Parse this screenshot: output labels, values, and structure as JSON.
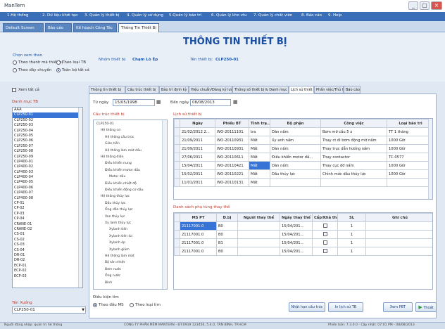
{
  "window": {
    "app_name": "ManTern",
    "buttons": [
      "_",
      "▢",
      "×"
    ]
  },
  "menu": [
    "1.Hệ thống",
    "2. Dữ liệu khởi tạo",
    "3. Quản lý thiết bị",
    "4. Quản lý sử dụng",
    "5.Quản lý bảo trì",
    "6. Quản lý kho vtu",
    "7. Quản lý chất viên",
    "8. Báo cáo",
    "9. Help"
  ],
  "doc_tabs": [
    "Default Screen",
    "Báo cáo",
    "Kế hoạch Công Tác",
    "Thông Tin Thiết Bị"
  ],
  "header": {
    "title": "THÔNG TIN THIẾT BỊ",
    "filter_label": "Chọn xem theo",
    "radio_options": [
      "Theo thanh mã thiết bị",
      "Theo loại TB",
      "Theo dây chuyền",
      "Toàn bộ tất cả"
    ],
    "device_label": "Nhóm thiết bị:",
    "device_value": "Chạm Lò Ép",
    "name_label": "Tên thiết bị:",
    "name_value": "CLP250-01"
  },
  "left": {
    "show_all_label": "Xem tất cả",
    "list_label": "Danh mục TB",
    "items": [
      "AAA",
      "CLP250-01",
      "CLP250-02",
      "CLP250-03",
      "CLP250-04",
      "CLP250-05",
      "CLP250-06",
      "CLP250-07",
      "CLP250-08",
      "CLP250-09",
      "CLP400-01",
      "CLP400-02",
      "CLP400-03",
      "CLP400-04",
      "CLP400-05",
      "CLP400-06",
      "CLP400-07",
      "CLP400-08",
      "CP-01",
      "CP-02",
      "CP-03",
      "CP-04",
      "CRANE-01",
      "CRANE-02",
      "CS-01",
      "CS-02",
      "CS-03",
      "CS-04",
      "DR-01",
      "DR-02",
      "ECP-01",
      "ECP-02",
      "ECP-03"
    ],
    "selected_index": 1,
    "factory_label": "Tên Xưởng",
    "factory_value": "CLP250-01"
  },
  "sub_tabs": [
    "Thông tin thiết bị",
    "Cấu trúc thiết bị",
    "Bảo trì định kỳ",
    "Hiệu chuẩn/Đăng ký lưu lộ",
    "Thông số thiết bị & Danh mục kiểm tra",
    "Lịch sử thiết bị",
    "Phần việc/Thủ tướng",
    "Báo cáo"
  ],
  "content": {
    "from_label": "Từ ngày",
    "from_value": "15/05/1998",
    "to_label": "Đến ngày",
    "to_value": "08/08/2013",
    "structure_label": "Cấu trúc thiết bị",
    "history_label": "Lịch sử thiết bị",
    "parts_label": "Danh sách phụ tùng thay thế",
    "search_by_label": "Điều kiện tìm",
    "search_options": [
      "Theo đầu MS",
      "Theo loại tìm"
    ]
  },
  "tree": [
    "CLP250-01",
    "Hệ thống cơ",
    "Hệ thống cấu trúc",
    "Giàn tiến",
    "Hệ thống làm mát dầu",
    "Hệ thống điện",
    "Điều khiển nung",
    "Điều khiển motor dầu",
    "Motor dầu",
    "Điều khiển nhiệt độ",
    "Điều khiển động cơ dầu",
    "Hệ thống thủy lực",
    "Dầu thủy lực",
    "Ống dẫn thủy lực",
    "Van thủy lực",
    "Xy lanh thủy lực",
    "Xylanh tiến",
    "Xylanh tiến lùi",
    "Xylanh ép",
    "Xylanh giảm",
    "Hệ thống làm mát",
    "Bộ tản nhiệt",
    "Bơm nước",
    "Ống nước",
    "Bình"
  ],
  "history": {
    "columns": [
      "Ngày",
      "Phiếu BT",
      "Tình trạ...",
      "Bộ phận",
      "Công việc",
      "Loại bảo trì"
    ],
    "rows": [
      [
        "21/02/2012 2...",
        "WO-20111101",
        "tra",
        "Dàn nấm",
        "Bơm mỡ cầu 5 x",
        "TT 1 tháng"
      ],
      [
        "21/09/2011",
        "WO-20110931",
        "Mất",
        "Xy anh nấm",
        "Thay ct đi bơm động mở nấm",
        "1000 Giờ"
      ],
      [
        "21/09/2011",
        "WO-20110931",
        "Mất",
        "Dàn nấm",
        "Thay trục dẫn hướng nấm",
        "1000 Giờ"
      ],
      [
        "27/06/2011",
        "WO-20110611",
        "Mất",
        "Điều khiển motor dầ...",
        "Thay contactor",
        "TC-0577"
      ],
      [
        "15/04/2011",
        "WO-20110421",
        "Mất",
        "Dàn nấm",
        "Thay cục đỡ nấm",
        "1000 Giờ"
      ],
      [
        "15/02/2011",
        "WO-20110221",
        "Mất",
        "Dầu thủy lực",
        "Chỉnh mức dầu thủy lực",
        "1000 Giờ"
      ],
      [
        "11/01/2011",
        "WO-20110131",
        "Mất",
        "",
        "",
        ""
      ]
    ]
  },
  "parts": {
    "columns": [
      "MS PT",
      "Đ.bị",
      "Người thay thế",
      "Ngày thay thế",
      "Cấp/Khả thảo",
      "SL",
      "Ghi chú"
    ],
    "rows": [
      [
        "21117001.0",
        "B0",
        "",
        "15/04/201...",
        "",
        "1",
        ""
      ],
      [
        "21117001.0",
        "B0",
        "",
        "15/04/201...",
        "",
        "1",
        ""
      ],
      [
        "21117001.0",
        "B1",
        "",
        "15/04/201...",
        "",
        "1",
        ""
      ],
      [
        "21117001.0",
        "B0",
        "",
        "15/04/201...",
        "",
        "1",
        ""
      ]
    ]
  },
  "buttons": {
    "update": "Nhật hạn cấu trúc",
    "history": "In lịch sử TB",
    "print": "Xem PBT",
    "exit": "Thoát"
  },
  "status": {
    "left": "Người đăng nhập: quản trị hệ thống",
    "center": "CÔNG TY PHẦN MỀM MANTERN - ĐT:0919 123456, 5.4.0, TÂN BÌNH, TP.HCM",
    "right": "Phiên bản: 7.3.0.0 - Cập nhật: 07:01 PM - 08/08/2013"
  }
}
